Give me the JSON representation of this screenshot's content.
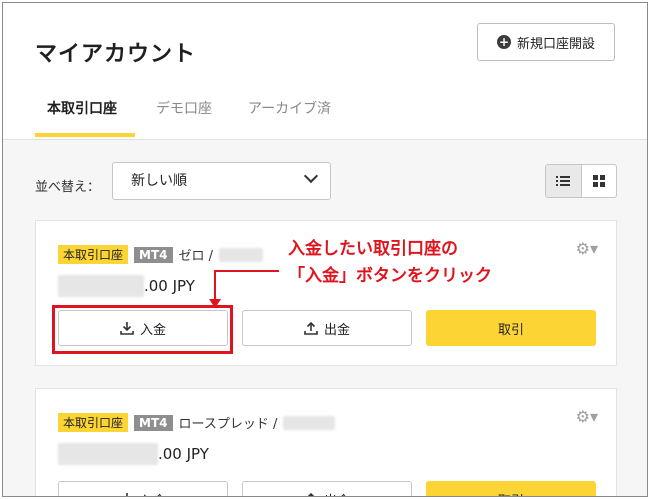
{
  "header": {
    "title": "マイアカウント",
    "new_account_button": "新規口座開設",
    "tabs": [
      "本取引口座",
      "デモ口座",
      "アーカイブ済"
    ]
  },
  "toolbar": {
    "sort_label": "並べ替え：",
    "sort_value": "新しい順"
  },
  "accounts": [
    {
      "badge": "本取引口座",
      "platform": "MT4",
      "type": "ゼロ /",
      "balance_suffix": ".00 JPY",
      "buttons": {
        "deposit": "入金",
        "withdraw": "出金",
        "trade": "取引"
      }
    },
    {
      "badge": "本取引口座",
      "platform": "MT4",
      "type": "ロースプレッド /",
      "balance_suffix": ".00 JPY",
      "buttons": {
        "deposit": "入金",
        "withdraw": "出金",
        "trade": "取引"
      }
    }
  ],
  "annotation": {
    "line1": "入金したい取引口座の",
    "line2": "「入金」ボタンをクリック",
    "color": "#e0141e"
  },
  "colors": {
    "accent": "#fcd535",
    "annotation": "#e0141e"
  }
}
